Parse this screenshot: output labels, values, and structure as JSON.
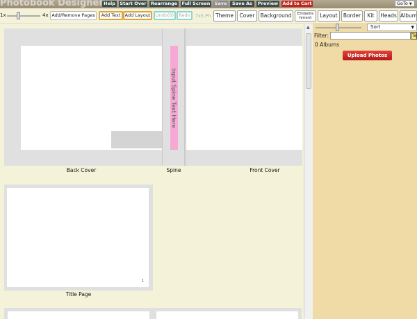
{
  "header": {
    "title": "Photobook Designer",
    "buttons": {
      "help": "Help",
      "start_over": "Start Over",
      "rearrange": "Rearrange",
      "full_screen": "Full Screen",
      "save": "Save",
      "save_as": "Save As",
      "preview": "Preview",
      "add_to_cart": "Add to Cart"
    },
    "goto": "GoTo"
  },
  "toolbar": {
    "zoom_min": "1x",
    "zoom_max": "4x",
    "zoom_level": 0.35,
    "add_remove_pages": "Add/Remove Pages",
    "add_text": "Add Text",
    "add_layout": "Add Layout",
    "undo": "Undo(0)",
    "redo": "Redo",
    "size": "7x5 Ph"
  },
  "tabs": [
    "Theme",
    "Cover",
    "Background",
    "Embellishment",
    "Layout",
    "Border",
    "Kit",
    "Heads",
    "Album"
  ],
  "tab_display": {
    "embellishment_line1": "Embellis",
    "embellishment_line2": "hment"
  },
  "workspace": {
    "spine_text": "Input Spine Text Here",
    "captions": {
      "back_cover": "Back Cover",
      "spine": "Spine",
      "front_cover": "Front Cover",
      "title_page": "Title Page"
    },
    "title_page_number": "1"
  },
  "panel": {
    "sort_label": "Sort",
    "filter_label": "Filter:",
    "filter_value": "",
    "filter_tag": "Ta",
    "albums_count": "0 Albums",
    "upload_button": "Upload Photos"
  },
  "colors": {
    "background": "#f4f3da",
    "panel": "#f0dba6",
    "spine": "#f5a9d4",
    "upload_button": "#c62a24",
    "add_to_cart": "#c5231f"
  }
}
